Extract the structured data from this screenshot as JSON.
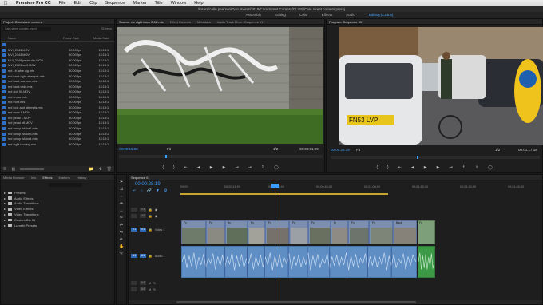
{
  "menubar": {
    "apple": "",
    "app": "Premiere Pro CC",
    "items": [
      "File",
      "Edit",
      "Clip",
      "Sequence",
      "Marker",
      "Title",
      "Window",
      "Help"
    ]
  },
  "titlebar": {
    "path": "/Users/colin.pearson/Documents/2018/Cam Street Corners/CLIPS/Cam street corners.prproj"
  },
  "workspaces": {
    "items": [
      "Assembly",
      "Editing",
      "Color",
      "Effects",
      "Audio",
      "Editing (CS5.5)"
    ],
    "active_index": 5
  },
  "project": {
    "tab": "Project: Cam street corners",
    "file": "Cam street corners.prproj",
    "items_count": "33 Items",
    "columns": [
      "Name",
      "Frame Rate",
      "Media Start"
    ],
    "rows": [
      {
        "name": "",
        "fr": "",
        "ms": ""
      },
      {
        "name": "MVI_2143.MOV",
        "fr": "50.00 fps",
        "ms": "13:13:1"
      },
      {
        "name": "MVI_2144.MOV",
        "fr": "50.00 fps",
        "ms": "13:13:1"
      },
      {
        "name": "MVI_2146 pedal clip.MOV",
        "fr": "50.00 fps",
        "ms": "13:13:1"
      },
      {
        "name": "MVI_2123 wolf.MOV",
        "fr": "50.00 fps",
        "ms": "13:13:1"
      },
      {
        "name": "red 1ft.table zig.mts",
        "fr": "50.00 fps",
        "ms": "13:13:1"
      },
      {
        "name": "red back right attempts.mts",
        "fr": "50.00 fps",
        "ms": "13:13:1"
      },
      {
        "name": "red back warmup.mts",
        "fr": "50.00 fps",
        "ms": "13:13:1"
      },
      {
        "name": "red back wide.mts",
        "fr": "50.00 fps",
        "ms": "13:13:1"
      },
      {
        "name": "red civil 50.MOV",
        "fr": "50.00 fps",
        "ms": "13:13:1"
      },
      {
        "name": "red cruise.mts",
        "fr": "50.00 fps",
        "ms": "13:13:1"
      },
      {
        "name": "red front.mts",
        "fr": "50.00 fps",
        "ms": "13:13:1"
      },
      {
        "name": "red look and attempts.mts",
        "fr": "50.00 fps",
        "ms": "13:13:1"
      },
      {
        "name": "red moto F.MOV",
        "fr": "50.00 fps",
        "ms": "13:13:1"
      },
      {
        "name": "red pedal 1.MOV",
        "fr": "50.00 fps",
        "ms": "13:13:1"
      },
      {
        "name": "red pedal off.MOV",
        "fr": "50.00 fps",
        "ms": "13:13:1"
      },
      {
        "name": "red runup fsfake1.mts",
        "fr": "50.00 fps",
        "ms": "13:13:1"
      },
      {
        "name": "red runup fsfake3.mts",
        "fr": "50.00 fps",
        "ms": "13:13:1"
      },
      {
        "name": "red runup fsfake4.mts",
        "fr": "50.00 fps",
        "ms": "13:13:1"
      },
      {
        "name": "red sight landing.mts",
        "fr": "50.00 fps",
        "ms": "13:13:1"
      }
    ]
  },
  "source": {
    "tabs": [
      "Source: vic sight.bonk 0-12.mts",
      "Effect Controls",
      "Metadata",
      "Audio Track Mixer: Sequence 01"
    ],
    "tc_in": "00:00:15:00",
    "fit": "Fit",
    "zoom": "1/2",
    "tc_dur": "00:00:01:29"
  },
  "program": {
    "tab": "Program: Sequence 01",
    "tc": "00:00:28:19",
    "fit": "Fit",
    "zoom": "1/2",
    "tc_dur": "00:01:17:18",
    "plate": "FN53 LVP"
  },
  "effects": {
    "tabs": [
      "Media Browser",
      "Info",
      "Effects",
      "Markers",
      "History"
    ],
    "active_tab": 2,
    "tree": [
      "Presets",
      "Audio Effects",
      "Audio Transitions",
      "Video Effects",
      "Video Transitions",
      "Custom Bin 01",
      "Lumetri Presets"
    ]
  },
  "timeline": {
    "tab": "Sequence 01",
    "tc": "00:00:28:19",
    "ruler": [
      "00:00",
      "00:00:15:00",
      "00:00:30:00",
      "00:00:45:00",
      "00:01:00:00",
      "00:01:15:00",
      "00:01:30:00",
      "00:01:45:00"
    ],
    "tracks": {
      "v3": "V3",
      "v2": "V2",
      "v1": "V1",
      "video1": "Video 1",
      "a1": "A1",
      "audio1": "Audio 1",
      "a2": "A2",
      "a3": "A3"
    },
    "clip_labels": [
      "Fx",
      "Fx",
      "fx",
      "Fx",
      "Fx",
      "Fx",
      "Fx",
      "fx",
      "Fx",
      "Fx",
      "Back",
      "Fx"
    ]
  }
}
